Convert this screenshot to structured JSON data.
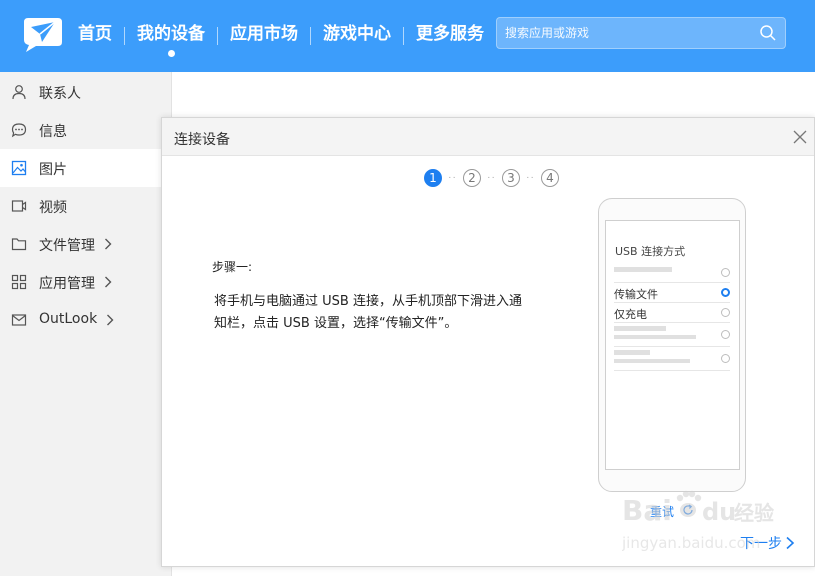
{
  "header": {
    "nav": [
      {
        "label": "首页",
        "active": false
      },
      {
        "label": "我的设备",
        "active": true
      },
      {
        "label": "应用市场",
        "active": false
      },
      {
        "label": "游戏中心",
        "active": false
      },
      {
        "label": "更多服务",
        "active": false
      }
    ],
    "search": {
      "placeholder": "搜索应用或游戏",
      "value": "",
      "icon": "search-icon"
    },
    "logo_icon": "paper-plane-logo"
  },
  "sidebar": {
    "items": [
      {
        "label": "联系人",
        "icon": "person-icon",
        "active": false,
        "has_arrow": false
      },
      {
        "label": "信息",
        "icon": "message-icon",
        "active": false,
        "has_arrow": false
      },
      {
        "label": "图片",
        "icon": "image-icon",
        "active": true,
        "has_arrow": false
      },
      {
        "label": "视频",
        "icon": "video-icon",
        "active": false,
        "has_arrow": false
      },
      {
        "label": "文件管理",
        "icon": "folder-icon",
        "active": false,
        "has_arrow": true
      },
      {
        "label": "应用管理",
        "icon": "apps-grid-icon",
        "active": false,
        "has_arrow": true
      },
      {
        "label": "OutLook",
        "icon": "mail-icon",
        "active": false,
        "has_arrow": true
      }
    ]
  },
  "dialog": {
    "title": "连接设备",
    "steps": [
      "1",
      "2",
      "3",
      "4"
    ],
    "current_step": 1,
    "step_heading": "步骤一:",
    "step_description": "将手机与电脑通过 USB 连接，从手机顶部下滑进入通知栏，点击 USB 设置，选择“传输文件”。",
    "phone": {
      "title": "USB 连接方式",
      "options": [
        "传输文件",
        "仅充电"
      ],
      "selected": "传输文件"
    },
    "retry_label": "重试",
    "next_label": "下一步"
  },
  "watermark": {
    "text": "Baidu经验",
    "url_text": "jingyan.baidu.com"
  },
  "colors": {
    "header_bg": "#3c9dfb",
    "accent": "#1e7ff0",
    "sidebar_bg": "#f2f2f2"
  }
}
